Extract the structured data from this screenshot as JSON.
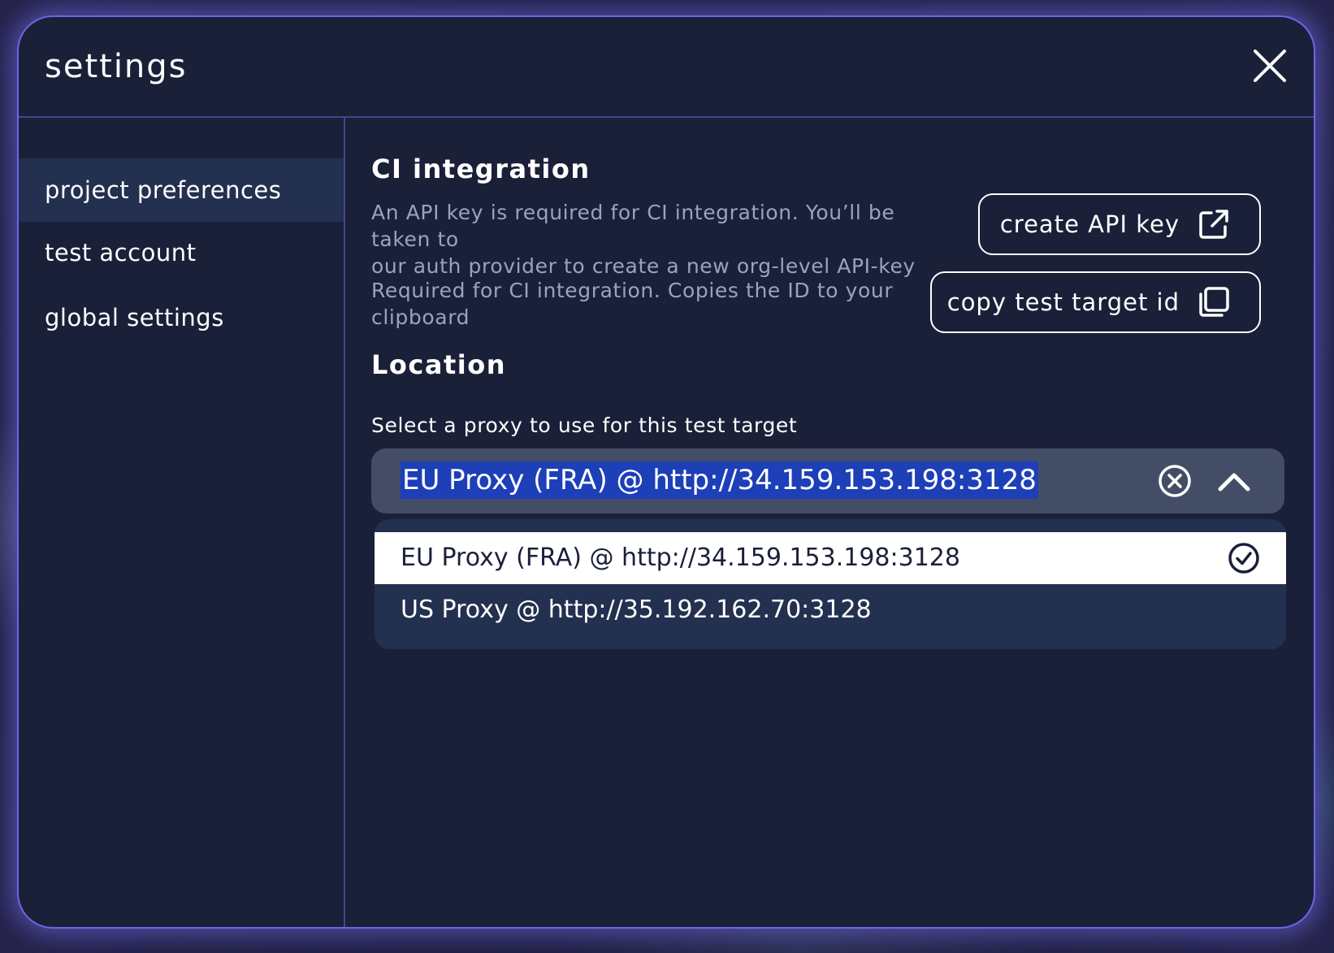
{
  "modal": {
    "title": "settings",
    "close_icon": "close-icon"
  },
  "sidebar": {
    "items": [
      {
        "label": "project preferences",
        "active": true
      },
      {
        "label": "test account",
        "active": false
      },
      {
        "label": "global settings",
        "active": false
      }
    ]
  },
  "ci_integration": {
    "title": "CI integration",
    "api_key_description_line1": "An API key is required for CI integration. You’ll be taken to",
    "api_key_description_line2": "our auth provider to create a new org-level API-key",
    "create_api_key_label": "create API key",
    "create_api_key_icon": "external-link-icon",
    "copy_description_line1": "Required for CI integration. Copies the ID to your",
    "copy_description_line2": "clipboard",
    "copy_id_label": "copy test target id",
    "copy_id_icon": "copy-icon"
  },
  "location": {
    "title": "Location",
    "field_label": "Select a proxy to use for this test target",
    "selected_value": "EU Proxy (FRA) @ http://34.159.153.198:3128",
    "clear_icon": "clear-circle-icon",
    "toggle_icon": "chevron-up-icon",
    "options": [
      {
        "label": "EU Proxy (FRA) @ http://34.159.153.198:3128",
        "selected": true
      },
      {
        "label": "US Proxy @ http://35.192.162.70:3128",
        "selected": false
      }
    ],
    "selected_check_icon": "check-circle-icon"
  },
  "colors": {
    "modal_bg": "#1b2039",
    "border_accent": "#6b66e6",
    "sidebar_active_bg": "#24304f",
    "select_bg": "#434e66",
    "text_highlight": "#1d3fb8",
    "muted_text": "#9aa3bd"
  }
}
